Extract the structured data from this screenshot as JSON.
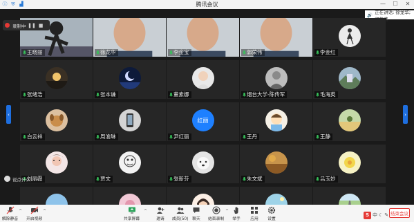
{
  "window": {
    "title": "腾讯会议"
  },
  "recording": {
    "label": "录制中"
  },
  "speaking": {
    "text": "正在讲话: 徐龙华; 郭荣伟"
  },
  "chat": {
    "hint": "说点什么..."
  },
  "participants": [
    {
      "name": "王晓丽",
      "kind": "video",
      "icon": "runner-photo"
    },
    {
      "name": "徐龙华",
      "kind": "video",
      "icon": "man-video"
    },
    {
      "name": "李金宝",
      "kind": "video",
      "icon": "man-video"
    },
    {
      "name": "郭荣伟",
      "kind": "video",
      "icon": "man-video"
    },
    {
      "name": "李金红",
      "kind": "avatar",
      "icon": "dancer-avatar"
    },
    {
      "name": "张绪浩",
      "kind": "avatar",
      "icon": "sunset-avatar"
    },
    {
      "name": "张本谦",
      "kind": "avatar",
      "icon": "moon-avatar"
    },
    {
      "name": "董素娜",
      "kind": "avatar",
      "icon": "child-avatar"
    },
    {
      "name": "烟台大学-陈传军",
      "kind": "avatar",
      "icon": "mono-avatar"
    },
    {
      "name": "毛海英",
      "kind": "avatar",
      "icon": "landscape-avatar"
    },
    {
      "name": "白云祥",
      "kind": "avatar",
      "icon": "dog-avatar"
    },
    {
      "name": "周渝琳",
      "kind": "avatar",
      "icon": "phone-avatar"
    },
    {
      "name": "尹红丽",
      "kind": "text",
      "icon": "text-avatar",
      "initials": "红丽"
    },
    {
      "name": "王丹",
      "kind": "avatar",
      "icon": "cartoon-avatar"
    },
    {
      "name": "王静",
      "kind": "avatar",
      "icon": "field-avatar"
    },
    {
      "name": "刘丽霞",
      "kind": "avatar",
      "icon": "flower-avatar"
    },
    {
      "name": "贾文",
      "kind": "avatar",
      "icon": "sketch-avatar"
    },
    {
      "name": "张新芬",
      "kind": "avatar",
      "icon": "dog2-avatar"
    },
    {
      "name": "朱文斌",
      "kind": "avatar",
      "icon": "autumn-avatar"
    },
    {
      "name": "吕玉妙",
      "kind": "avatar",
      "icon": "yellow-avatar"
    },
    {
      "name": "",
      "kind": "avatar",
      "icon": "sky-avatar"
    },
    {
      "name": "",
      "kind": "avatar",
      "icon": "pink-avatar"
    },
    {
      "name": "",
      "kind": "avatar",
      "icon": "girl-avatar"
    },
    {
      "name": "",
      "kind": "avatar",
      "icon": "beach-avatar"
    },
    {
      "name": "",
      "kind": "avatar",
      "icon": "road-avatar"
    }
  ],
  "toolbar": {
    "mute": "解除静音",
    "video": "开启视频",
    "share": "共享屏幕",
    "invite": "邀请",
    "members": "成员(50)",
    "chat": "聊天",
    "record": "结束录制",
    "hand": "举手",
    "apps": "应用",
    "settings": "设置",
    "end": "结束会议"
  },
  "ime": {
    "logo": "S",
    "label": "中"
  }
}
